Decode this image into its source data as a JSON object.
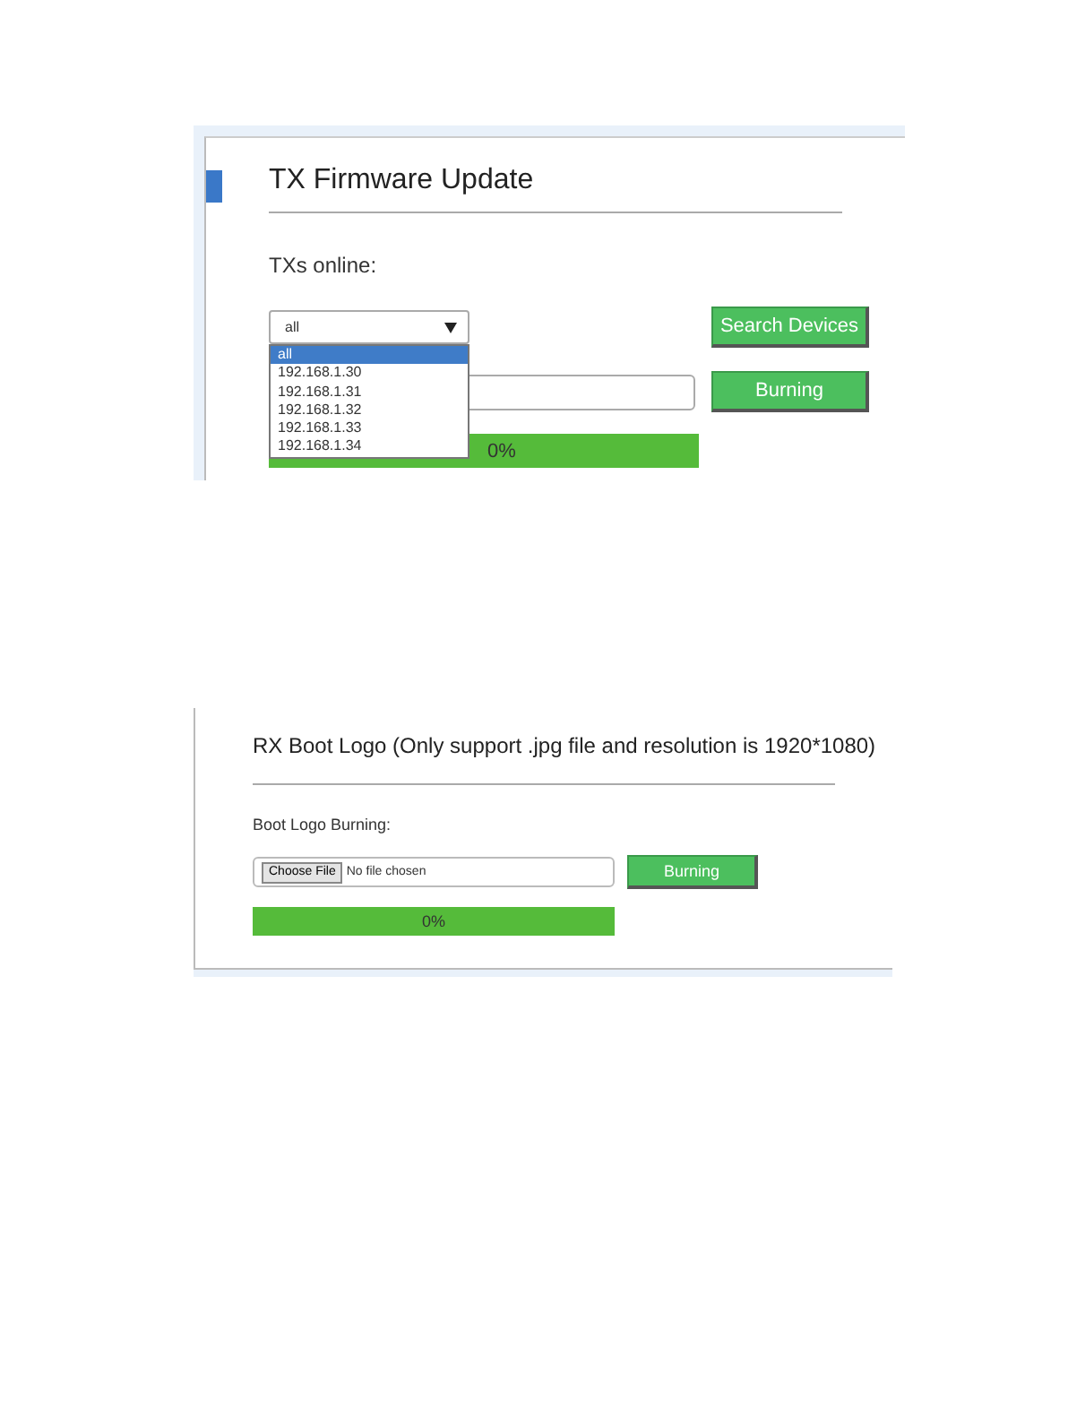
{
  "tx_firmware_update": {
    "title": "TX Firmware Update",
    "online_label": "TXs online:",
    "device_select": {
      "value": "all",
      "options": [
        {
          "label": "all",
          "selected": true
        },
        {
          "label": "192.168.1.30",
          "selected": false
        },
        {
          "label": "192.168.1.31",
          "selected": false
        },
        {
          "label": "192.168.1.32",
          "selected": false
        },
        {
          "label": "192.168.1.33",
          "selected": false
        },
        {
          "label": "192.168.1.34",
          "selected": false
        }
      ]
    },
    "search_button": "Search Devices",
    "burn_button": "Burning",
    "progress": {
      "level": 1,
      "text": "0%"
    }
  },
  "rx_boot_logo": {
    "title": "RX Boot Logo (Only support .jpg file and resolution is 1920*1080)",
    "burning_label": "Boot Logo Burning:",
    "choose_file_button": "Choose File",
    "file_status": "No file chosen",
    "burn_button": "Burning",
    "progress": {
      "level": 1,
      "text": "0%"
    }
  }
}
